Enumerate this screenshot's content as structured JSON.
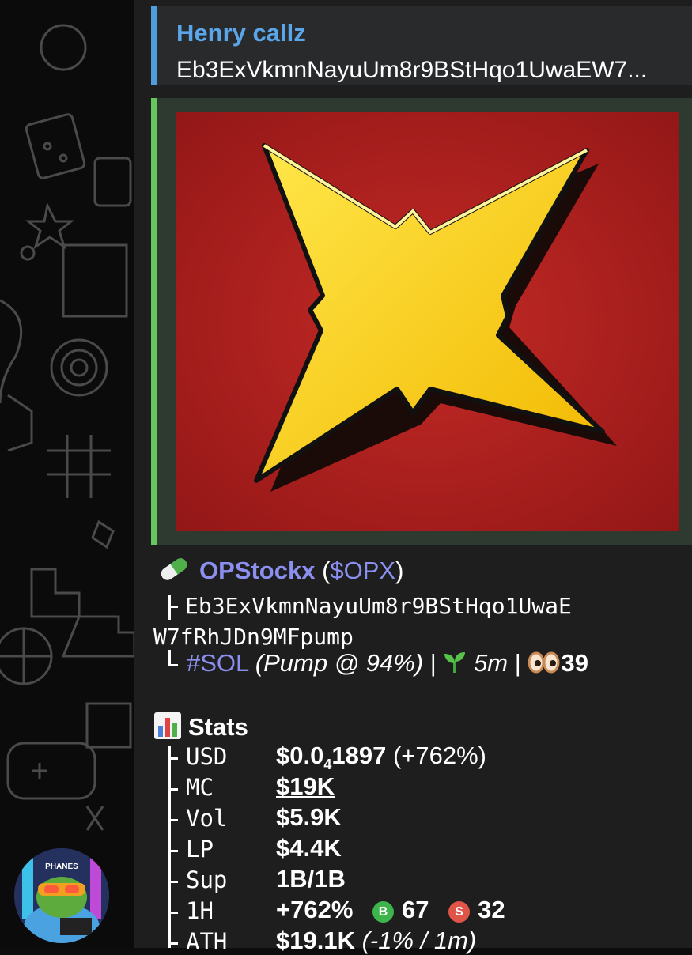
{
  "reply": {
    "sender": "Henry callz",
    "text": "Eb3ExVkmnNayuUm8r9BStHqo1UwaEW7..."
  },
  "token": {
    "name": "OPStockx",
    "ticker_open": "(",
    "ticker": "$OPX",
    "ticker_close": ")",
    "address_line1": "Eb3ExVkmnNayuUm8r9BStHqo1UwaE",
    "address_line2": "W7fRhJDn9MFpump",
    "chain": "#SOL",
    "pump_info": "(Pump @ 94%)",
    "sep1": "|",
    "age": "5m",
    "sep2": "|",
    "views": "39"
  },
  "stats": {
    "title": "Stats",
    "rows": [
      {
        "label": "USD",
        "value": "$0.0",
        "sub": "4",
        "value_tail": "1897",
        "extra": " (+762%)"
      },
      {
        "label": "MC",
        "value": "$19K"
      },
      {
        "label": "Vol",
        "value": "$5.9K"
      },
      {
        "label": "LP",
        "value": "$4.4K"
      },
      {
        "label": "Sup",
        "value": "1B/1B"
      },
      {
        "label": "1H",
        "value": "+762%",
        "buys": "67",
        "sells": "32",
        "buy_glyph": "B",
        "sell_glyph": "S"
      },
      {
        "label": "ATH",
        "value": "$19.1K",
        "extra": " (-1% / 1m)"
      }
    ]
  },
  "avatar": {
    "caption": "PHANES"
  },
  "colors": {
    "reply_accent": "#4f9cdf",
    "media_accent": "#64c85c",
    "link": "#8a8ff0",
    "buy": "#3db54a",
    "sell": "#e05548"
  },
  "icons": [
    "pill-icon",
    "seedling-icon",
    "eyes-icon",
    "bar-chart-icon",
    "buy-icon",
    "sell-icon",
    "star-logo"
  ]
}
